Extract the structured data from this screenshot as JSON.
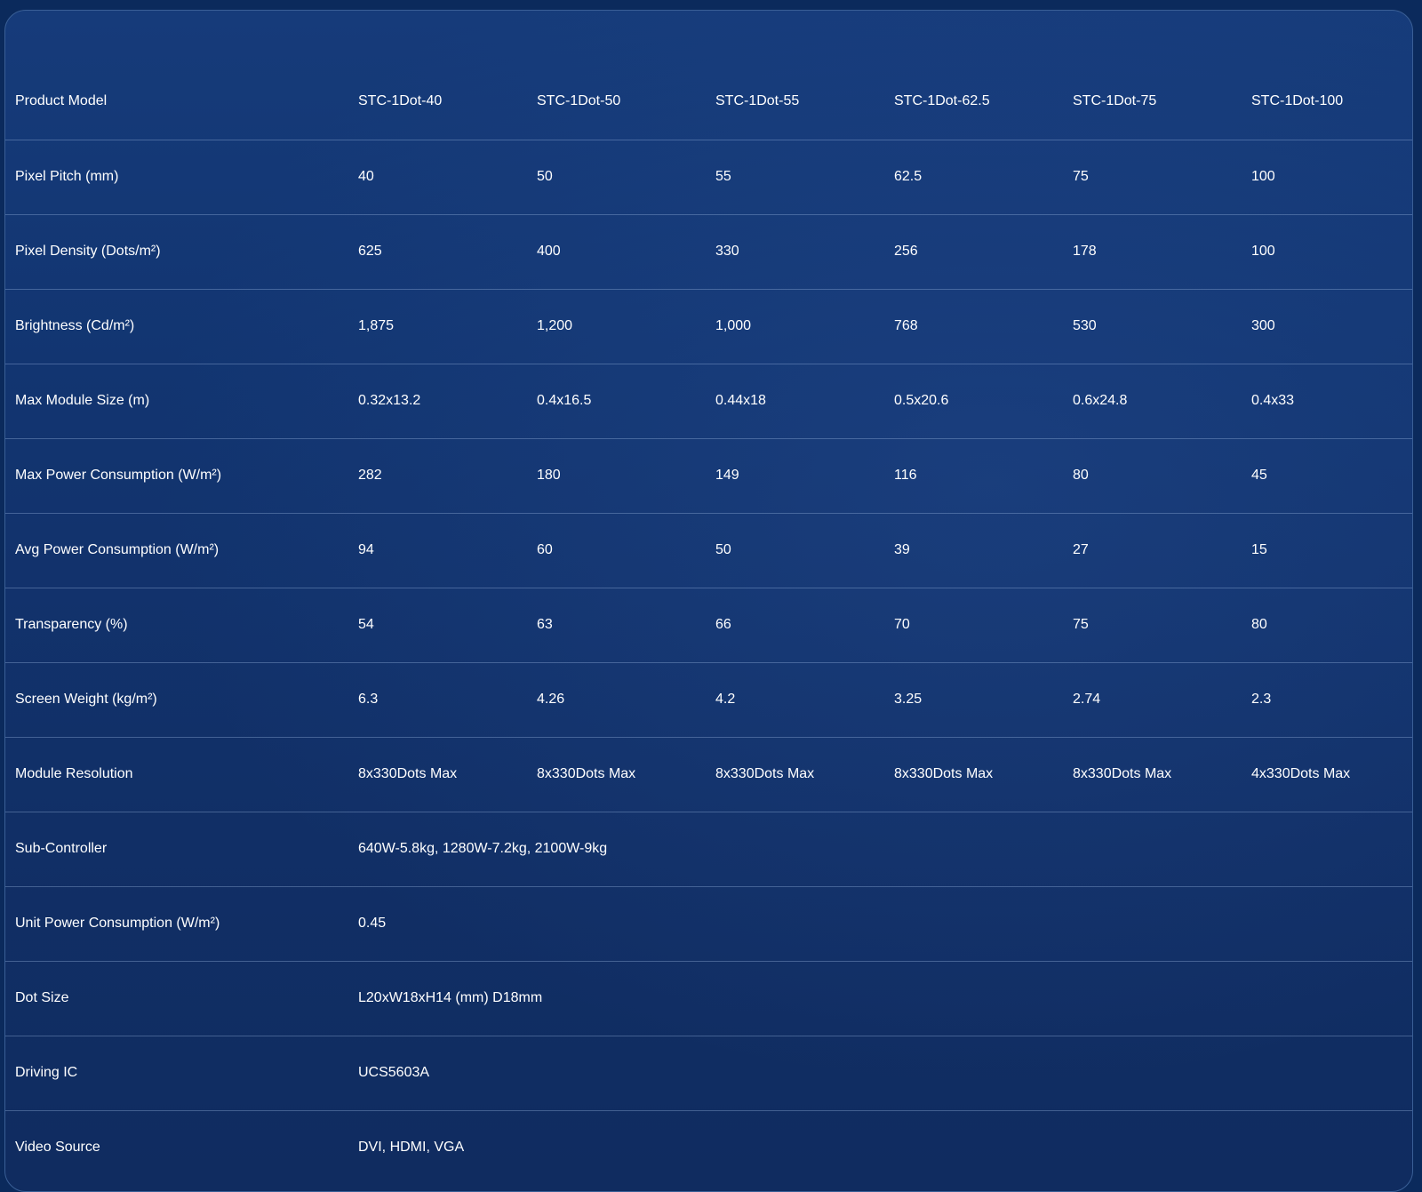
{
  "table": {
    "headers": [
      "Product Model",
      "STC-1Dot-40",
      "STC-1Dot-50",
      "STC-1Dot-55",
      "STC-1Dot-62.5",
      "STC-1Dot-75",
      "STC-1Dot-100"
    ],
    "rows": [
      {
        "label": "Pixel Pitch (mm)",
        "values": [
          "40",
          "50",
          "55",
          "62.5",
          "75",
          "100"
        ]
      },
      {
        "label": "Pixel Density (Dots/m²)",
        "values": [
          "625",
          "400",
          "330",
          "256",
          "178",
          "100"
        ]
      },
      {
        "label": "Brightness (Cd/m²)",
        "values": [
          "1,875",
          "1,200",
          "1,000",
          "768",
          "530",
          "300"
        ]
      },
      {
        "label": "Max Module Size (m)",
        "values": [
          "0.32x13.2",
          "0.4x16.5",
          "0.44x18",
          "0.5x20.6",
          "0.6x24.8",
          "0.4x33"
        ]
      },
      {
        "label": "Max Power Consumption (W/m²)",
        "values": [
          "282",
          "180",
          "149",
          "116",
          "80",
          "45"
        ]
      },
      {
        "label": "Avg Power Consumption (W/m²)",
        "values": [
          "94",
          "60",
          "50",
          "39",
          "27",
          "15"
        ]
      },
      {
        "label": "Transparency (%)",
        "values": [
          "54",
          "63",
          "66",
          "70",
          "75",
          "80"
        ]
      },
      {
        "label": "Screen Weight (kg/m²)",
        "values": [
          "6.3",
          "4.26",
          "4.2",
          "3.25",
          "2.74",
          "2.3"
        ]
      },
      {
        "label": "Module Resolution",
        "values": [
          "8x330Dots Max",
          "8x330Dots Max",
          "8x330Dots Max",
          "8x330Dots Max",
          "8x330Dots Max",
          "4x330Dots Max"
        ]
      },
      {
        "label": "Sub-Controller",
        "values": [
          "640W-5.8kg, 1280W-7.2kg, 2100W-9kg"
        ]
      },
      {
        "label": "Unit Power Consumption (W/m²)",
        "values": [
          "0.45"
        ]
      },
      {
        "label": "Dot Size",
        "values": [
          "L20xW18xH14 (mm) D18mm"
        ]
      },
      {
        "label": "Driving IC",
        "values": [
          "UCS5603A"
        ]
      },
      {
        "label": "Video Source",
        "values": [
          "DVI, HDMI, VGA"
        ]
      }
    ]
  }
}
